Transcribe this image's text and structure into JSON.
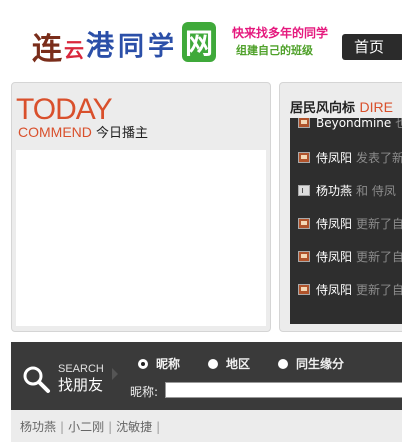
{
  "header": {
    "logo": {
      "chars": [
        "连",
        "云",
        "港",
        "同",
        "学",
        "网"
      ]
    },
    "slogan_line1": "快来找多年的同学",
    "slogan_line2": "组建自己的班级",
    "nav_home": "首页"
  },
  "today": {
    "title": "TODAY",
    "sub_en": "COMMEND",
    "sub_cn": "今日播主"
  },
  "direction": {
    "title_cn": "居民风向标",
    "title_en": "DIRE",
    "feed": [
      {
        "icon": "image-icon",
        "user": "Beyondmine",
        "action": "也"
      },
      {
        "icon": "image-icon",
        "user": "侍凤阳",
        "action": "发表了新"
      },
      {
        "icon": "doc-icon",
        "user": "杨功燕",
        "action": "和 侍凤"
      },
      {
        "icon": "image-icon",
        "user": "侍凤阳",
        "action": "更新了自"
      },
      {
        "icon": "image-icon",
        "user": "侍凤阳",
        "action": "更新了自"
      },
      {
        "icon": "image-icon",
        "user": "侍凤阳",
        "action": "更新了自"
      }
    ]
  },
  "search": {
    "label_en": "SEARCH",
    "label_cn": "找朋友",
    "options": [
      {
        "label": "昵称",
        "selected": true
      },
      {
        "label": "地区",
        "selected": false
      },
      {
        "label": "同生缘分",
        "selected": false
      }
    ],
    "nick_label": "昵称:",
    "nick_value": ""
  },
  "names": [
    "杨功燕",
    "小二刚",
    "沈敏捷"
  ],
  "colors": {
    "accent": "#d9502c",
    "dark": "#2e2e2e",
    "panel": "#ececec"
  }
}
